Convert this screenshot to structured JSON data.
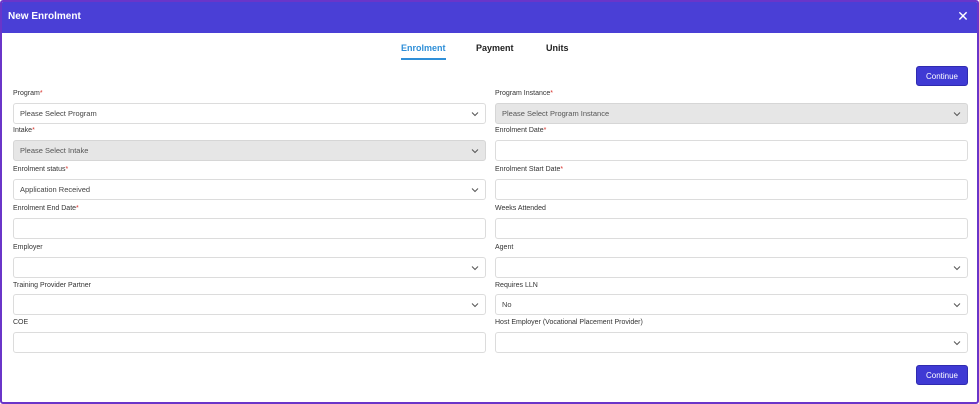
{
  "header": {
    "title": "New Enrolment",
    "close_icon": "close-icon"
  },
  "tabs": [
    {
      "label": "Enrolment",
      "active": true
    },
    {
      "label": "Payment",
      "active": false
    },
    {
      "label": "Units",
      "active": false
    }
  ],
  "actions": {
    "continue_label": "Continue"
  },
  "fields": {
    "program": {
      "label": "Program",
      "required": "*",
      "value": "Please Select Program"
    },
    "program_instance": {
      "label": "Program Instance",
      "required": "*",
      "value": "Please Select Program Instance"
    },
    "intake": {
      "label": "Intake",
      "required": "*",
      "value": "Please Select Intake"
    },
    "enrolment_date": {
      "label": "Enrolment Date",
      "required": "*",
      "value": ""
    },
    "enrolment_status": {
      "label": "Enrolment status",
      "required": "*",
      "value": "Application Received"
    },
    "enrolment_start_date": {
      "label": "Enrolment Start Date",
      "required": "*",
      "value": ""
    },
    "enrolment_end_date": {
      "label": "Enrolment End Date",
      "required": "*",
      "value": ""
    },
    "weeks_attended": {
      "label": "Weeks Attended",
      "value": ""
    },
    "employer": {
      "label": "Employer",
      "value": ""
    },
    "agent": {
      "label": "Agent",
      "value": ""
    },
    "training_provider_partner": {
      "label": "Training Provider Partner",
      "value": ""
    },
    "requires_lln": {
      "label": "Requires LLN",
      "value": "No"
    },
    "coe": {
      "label": "COE",
      "value": ""
    },
    "host_employer": {
      "label": "Host Employer (Vocational Placement Provider)",
      "value": ""
    }
  },
  "colors": {
    "header": "#4a3fd6",
    "accent": "#2f8fd8",
    "button": "#3f3ad4",
    "required": "#d8322b",
    "border": "#6a35c9"
  }
}
